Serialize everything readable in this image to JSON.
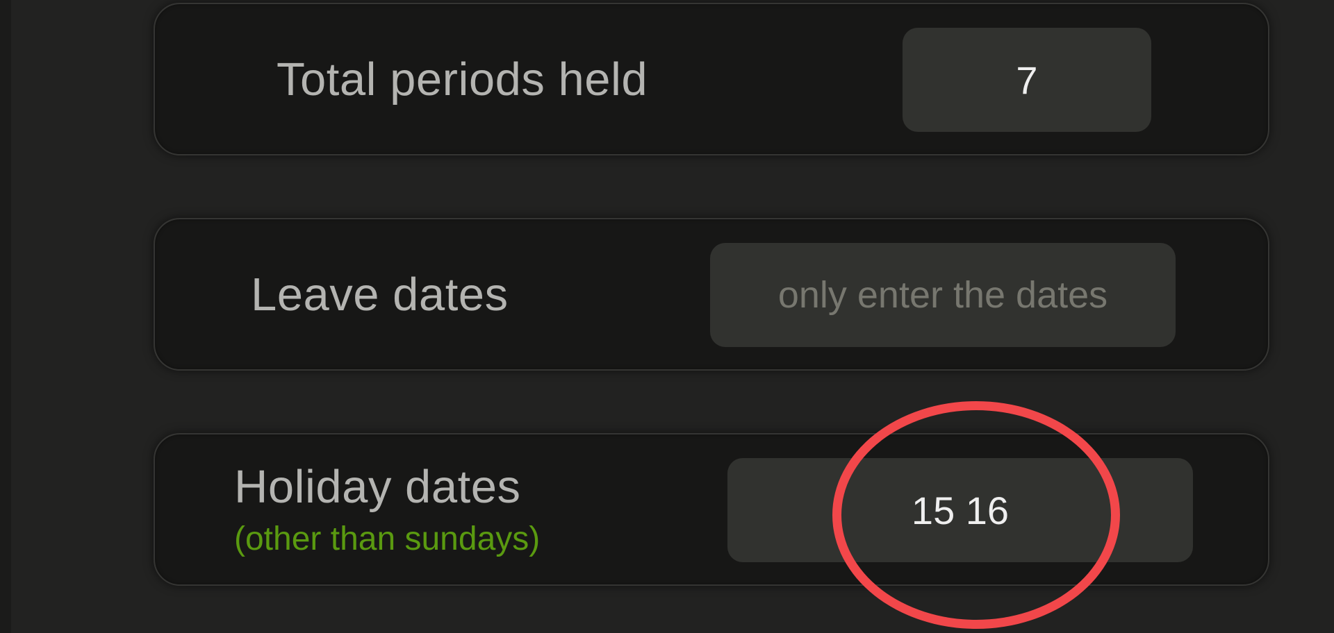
{
  "rows": [
    {
      "label": "Total periods held",
      "value": "7",
      "placeholder": ""
    },
    {
      "label": "Leave dates",
      "value": "",
      "placeholder": "only enter the dates"
    },
    {
      "label": "Holiday dates",
      "sublabel": "(other than sundays)",
      "value": "15 16",
      "placeholder": ""
    }
  ],
  "colors": {
    "background": "#222221",
    "card": "#171716",
    "field": "#31322f",
    "label": "#b4b4b1",
    "sublabel": "#5a9a10",
    "annotation": "#f2474a"
  }
}
